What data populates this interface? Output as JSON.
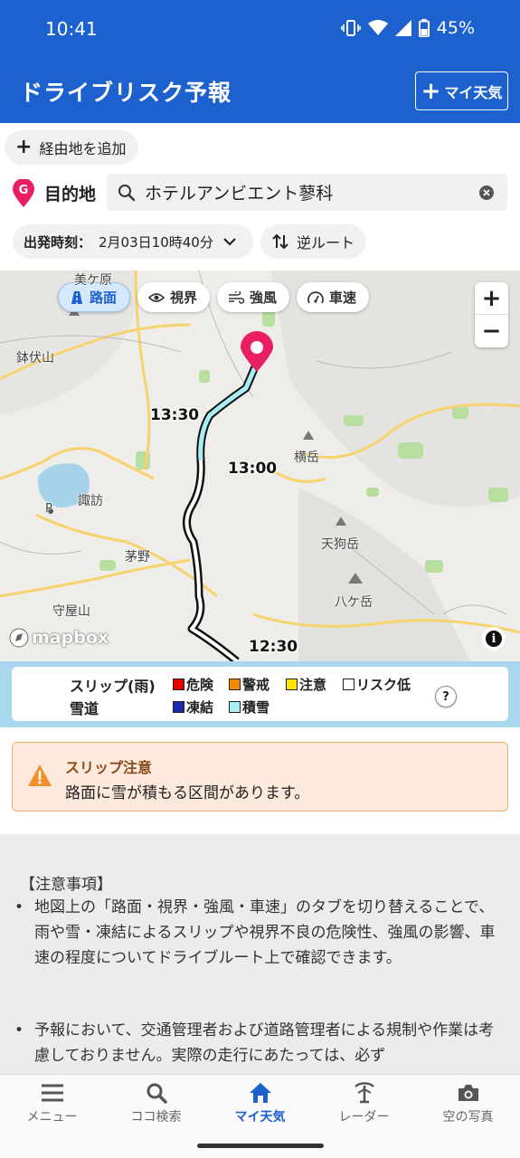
{
  "status": {
    "time": "10:41",
    "battery": "45%"
  },
  "header": {
    "title": "ドライブリスク予報",
    "my_weather_label": "マイ天気"
  },
  "form": {
    "add_waypoint_label": "経由地を追加",
    "destination_label": "目的地",
    "destination_value": "ホテルアンビエント蓼科",
    "departure_label": "出発時刻：",
    "departure_value": "2月03日10時40分",
    "reverse_label": "逆ルート"
  },
  "map": {
    "tabs": [
      {
        "label": "路面",
        "icon": "road-icon",
        "active": true
      },
      {
        "label": "視界",
        "icon": "eye-icon",
        "active": false
      },
      {
        "label": "強風",
        "icon": "wind-icon",
        "active": false
      },
      {
        "label": "車速",
        "icon": "speedometer-icon",
        "active": false
      }
    ],
    "zoom_in": "+",
    "zoom_out": "−",
    "places": [
      "美ケ原",
      "鉢伏山",
      "諏訪",
      "茅野",
      "守屋山",
      "横岳",
      "天狗岳",
      "八ケ岳",
      "P"
    ],
    "times": [
      "13:30",
      "13:00",
      "12:30"
    ],
    "attribution": "mapbox",
    "info": "i"
  },
  "legend": {
    "slip_title": "スリップ(雨)",
    "snow_title": "雪道",
    "slip_items": [
      {
        "label": "危険",
        "color": "#e60000"
      },
      {
        "label": "警戒",
        "color": "#f28a00"
      },
      {
        "label": "注意",
        "color": "#ffe600"
      },
      {
        "label": "リスク低",
        "color": "#ffffff"
      }
    ],
    "snow_items": [
      {
        "label": "凍結",
        "color": "#1a2aa8"
      },
      {
        "label": "積雪",
        "color": "#a8ecf4"
      }
    ],
    "help": "?"
  },
  "alert": {
    "title": "スリップ注意",
    "body": "路面に雪が積もる区間があります。"
  },
  "notes": {
    "title": "【注意事項】",
    "items": [
      "地図上の「路面・視界・強風・車速」のタブを切り替えることで、雨や雪・凍結によるスリップや視界不良の危険性、強風の影響、車速の程度についてドライブルート上で確認できます。",
      "予報において、交通管理者および道路管理者による規制や作業は考慮しておりません。実際の走行にあたっては、必ず"
    ]
  },
  "nav": {
    "items": [
      {
        "label": "メニュー",
        "icon": "menu-icon",
        "active": false
      },
      {
        "label": "ココ検索",
        "icon": "search-icon",
        "active": false
      },
      {
        "label": "マイ天気",
        "icon": "home-icon",
        "active": true
      },
      {
        "label": "レーダー",
        "icon": "radar-icon",
        "active": false
      },
      {
        "label": "空の写真",
        "icon": "camera-icon",
        "active": false
      }
    ]
  },
  "colors": {
    "brand": "#1d61cf",
    "legend_band": "#a9d8ee",
    "alert_bg": "#fdeadd",
    "alert_border": "#f0b06a",
    "pin": "#e91e63"
  }
}
